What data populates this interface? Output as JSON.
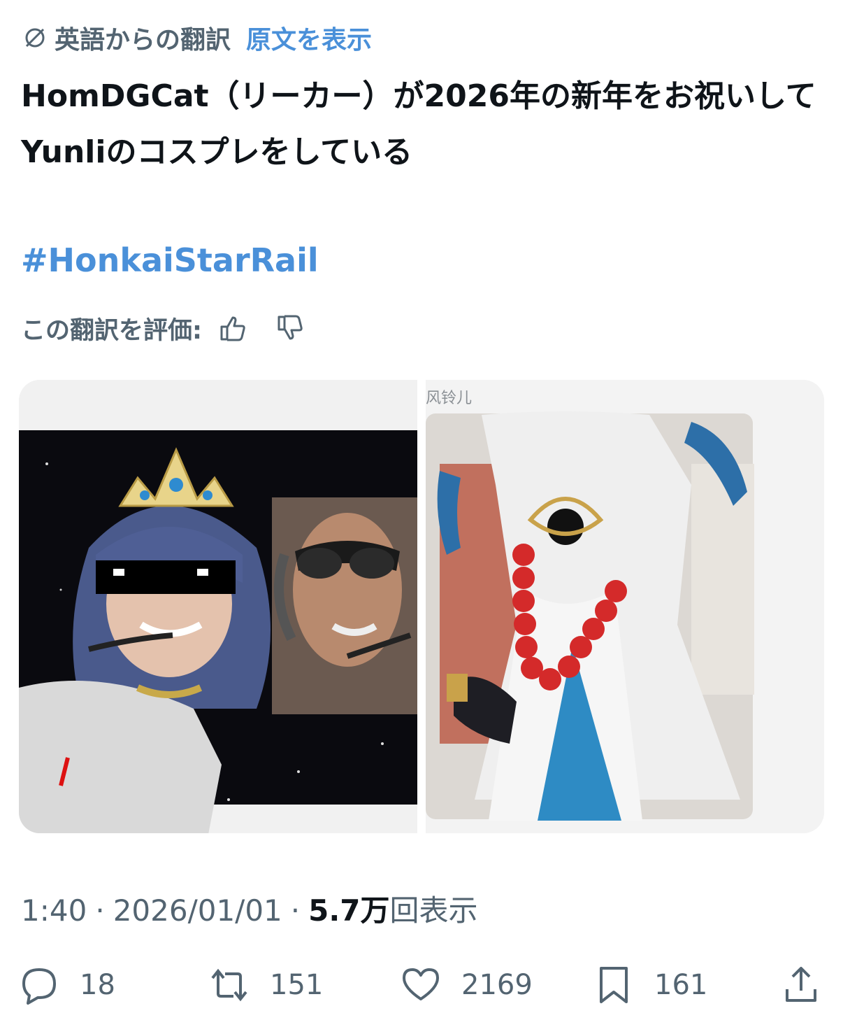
{
  "translation": {
    "label": "英語からの翻訳",
    "show_original": "原文を表示"
  },
  "tweet": {
    "text": "HomDGCat（リーカー）が2026年の新年をお祝いしてYunliのコスプレをしている",
    "hashtag": "#HonkaiStarRail"
  },
  "rate": {
    "label": "この翻訳を評価:"
  },
  "media": {
    "watermark": "风铃儿"
  },
  "meta": {
    "time": "1:40",
    "date": "2026/01/01",
    "separator": "·",
    "views_number": "5.7万",
    "views_label": "回表示"
  },
  "actions": {
    "replies": "18",
    "reposts": "151",
    "likes": "2169",
    "bookmarks": "161"
  },
  "colors": {
    "link": "#4a90d9",
    "secondary": "#536471",
    "text": "#0f1419"
  }
}
